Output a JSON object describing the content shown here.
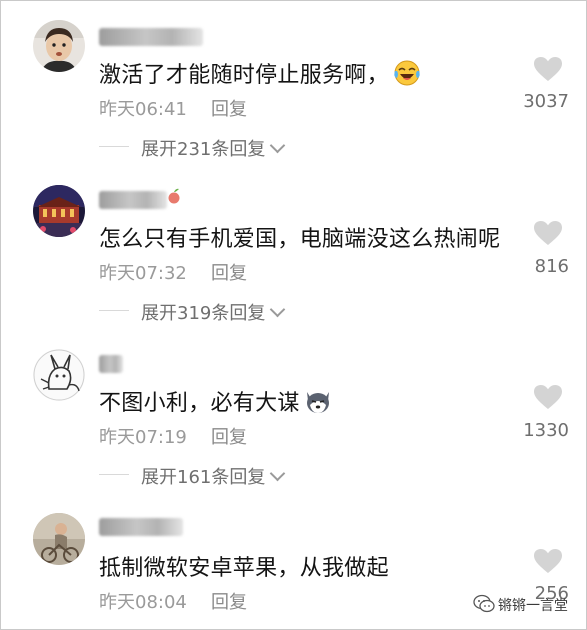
{
  "comments": [
    {
      "text": "激活了才能随时停止服务啊，",
      "emoji": "laughing-crying-emoji",
      "time": "昨天06:41",
      "reply": "回复",
      "likes": "3037",
      "expand": "展开231条回复"
    },
    {
      "text": "怎么只有手机爱国，电脑端没这么热闹呢",
      "time": "昨天07:32",
      "reply": "回复",
      "likes": "816",
      "expand": "展开319条回复"
    },
    {
      "text": "不图小利，必有大谋",
      "emoji": "husky-dog-emoji",
      "time": "昨天07:19",
      "reply": "回复",
      "likes": "1330",
      "expand": "展开161条回复"
    },
    {
      "text": "抵制微软安卓苹果，从我做起",
      "time": "昨天08:04",
      "reply": "回复",
      "likes": "256"
    }
  ],
  "watermark": {
    "text": "锵锵一言堂"
  },
  "colors": {
    "text": "#141414",
    "meta": "#9a9a9a",
    "heart": "#d4d4d4"
  }
}
